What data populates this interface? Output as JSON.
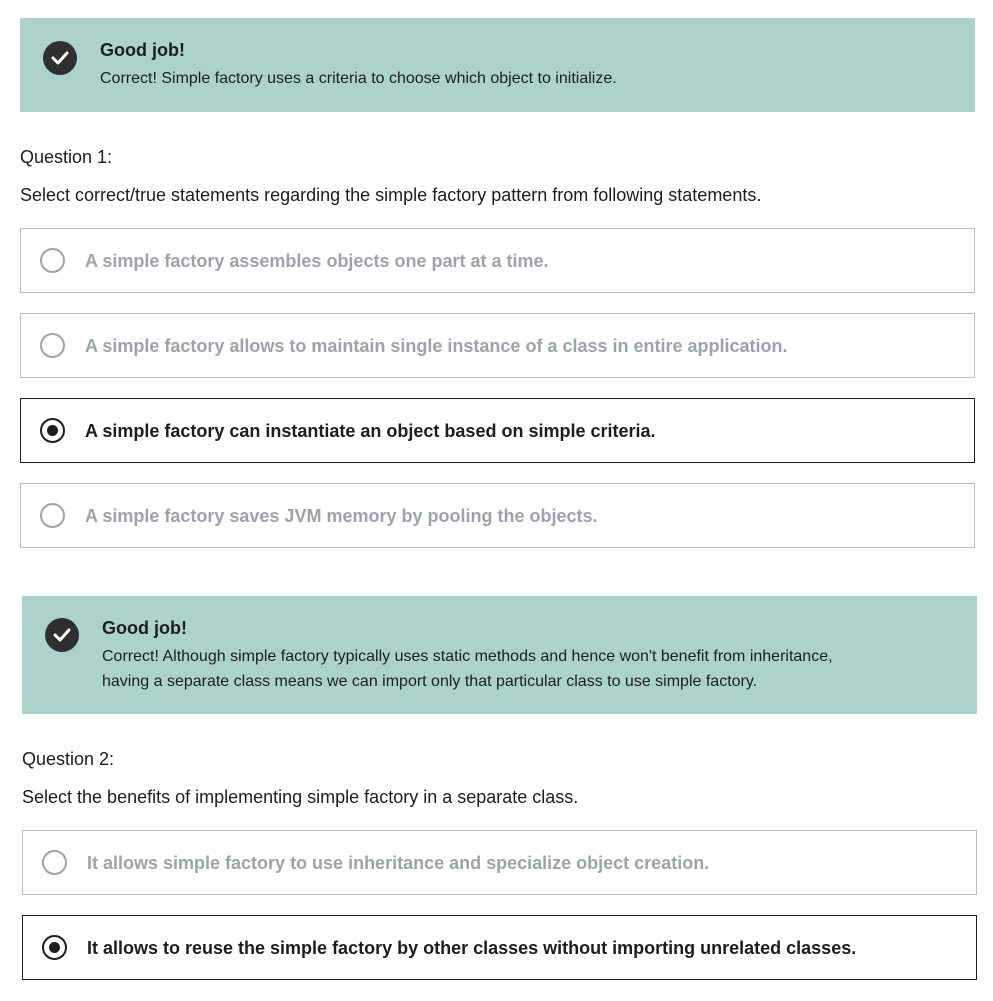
{
  "feedback1": {
    "title": "Good job!",
    "message": "Correct! Simple factory uses a criteria to choose which object to initialize."
  },
  "question1": {
    "number": "Question 1:",
    "prompt": "Select correct/true statements regarding the simple factory pattern from following statements.",
    "options": [
      {
        "label": "A simple factory assembles objects one part at a time.",
        "selected": false
      },
      {
        "label": "A simple factory allows to maintain single instance of a class in entire application.",
        "selected": false
      },
      {
        "label": "A simple factory can instantiate an object based on simple criteria.",
        "selected": true
      },
      {
        "label": "A simple factory saves JVM memory by pooling the objects.",
        "selected": false
      }
    ]
  },
  "feedback2": {
    "title": "Good job!",
    "message_line1": "Correct! Although simple factory typically uses static methods and hence won't benefit from inheritance,",
    "message_line2": "having a separate class means we can import only that particular class to use simple factory."
  },
  "question2": {
    "number": "Question 2:",
    "prompt": "Select the benefits of implementing simple factory in a separate class.",
    "options": [
      {
        "label": "It allows simple factory to use inheritance and specialize object creation.",
        "selected": false
      },
      {
        "label": "It allows to reuse the simple factory by other classes without importing unrelated classes.",
        "selected": true
      }
    ]
  },
  "colors": {
    "feedback_bg": "#acd2cc",
    "text_dark": "#1c1d1f",
    "text_muted": "#9da3a7",
    "border": "#b8bcc0"
  }
}
